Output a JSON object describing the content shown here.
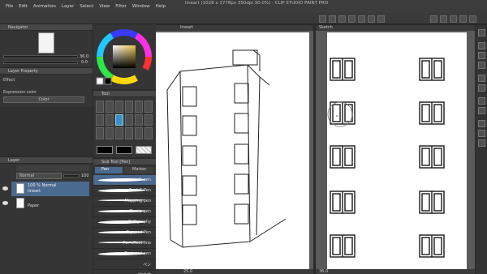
{
  "menu": [
    "File",
    "Edit",
    "Animation",
    "Layer",
    "Select",
    "View",
    "Filter",
    "Window",
    "Help"
  ],
  "title": "lineart (1028 x 1778px 350dpi 30.0%) - CLIP STUDIO PAINT PRO",
  "navigator": {
    "label": "Navigator",
    "zoom": "36.0",
    "angle": "0.0"
  },
  "color_wheel": {
    "hue_accent": "#e8c24a"
  },
  "layer_property": {
    "label": "Layer Property",
    "effect_label": "Effect",
    "expression_color_label": "Expression color",
    "expression_color_value": "Color"
  },
  "tool_property": {
    "label": "Tool"
  },
  "layer_panel": {
    "label": "Layer",
    "blend_mode": "Normal",
    "opacity": "100",
    "layers": [
      {
        "name_line1": "100 % Normal",
        "name_line2": "lineart",
        "selected": true
      },
      {
        "name_line1": "Paper",
        "name_line2": "",
        "selected": false
      }
    ]
  },
  "subtool": {
    "label": "Sub Tool [Pen]",
    "tabs": [
      "Pen",
      "Marker"
    ],
    "brushes": [
      "G-pen",
      "Real G-Pen",
      "Mapping pen",
      "Turnip pen",
      "Calligraphy",
      "Tapered Pen",
      "For effect line",
      "Textured pen",
      "ペン",
      "sketch"
    ]
  },
  "canvas_left": {
    "tab": "lineart",
    "zoom": "25.0"
  },
  "canvas_right": {
    "tab": "Sketch",
    "zoom": "36.0"
  },
  "accent": "#4b6a8f"
}
